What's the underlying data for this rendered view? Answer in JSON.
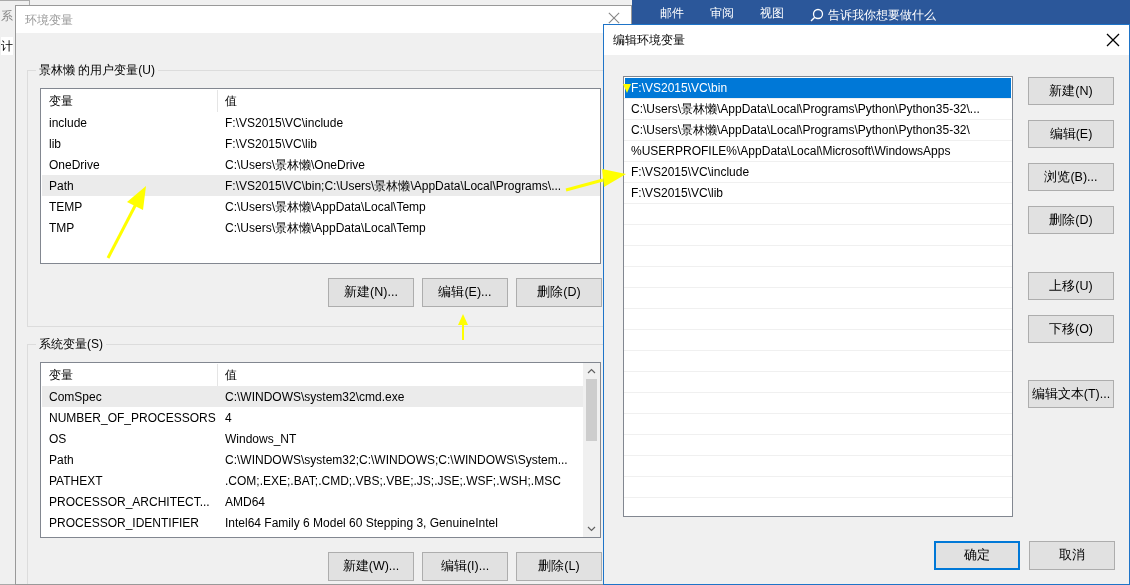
{
  "background_window": {
    "title": "系",
    "tab": "计"
  },
  "ribbon": {
    "tabs": [
      "邮件",
      "审阅",
      "视图"
    ],
    "search_hint": "告诉我你想要做什么"
  },
  "env_dialog": {
    "title": "环境变量",
    "active": false,
    "user_vars": {
      "label": "景林懒 的用户变量(U)",
      "columns": [
        "变量",
        "值"
      ],
      "rows": [
        {
          "name": "include",
          "value": "F:\\VS2015\\VC\\include",
          "selected": false
        },
        {
          "name": "lib",
          "value": "F:\\VS2015\\VC\\lib",
          "selected": false
        },
        {
          "name": "OneDrive",
          "value": "C:\\Users\\景林懒\\OneDrive",
          "selected": false
        },
        {
          "name": "Path",
          "value": "F:\\VS2015\\VC\\bin;C:\\Users\\景林懒\\AppData\\Local\\Programs\\...",
          "selected": true
        },
        {
          "name": "TEMP",
          "value": "C:\\Users\\景林懒\\AppData\\Local\\Temp",
          "selected": false
        },
        {
          "name": "TMP",
          "value": "C:\\Users\\景林懒\\AppData\\Local\\Temp",
          "selected": false
        }
      ],
      "buttons": [
        "新建(N)...",
        "编辑(E)...",
        "删除(D)"
      ]
    },
    "system_vars": {
      "label": "系统变量(S)",
      "columns": [
        "变量",
        "值"
      ],
      "rows": [
        {
          "name": "ComSpec",
          "value": "C:\\WINDOWS\\system32\\cmd.exe",
          "selected": true
        },
        {
          "name": "NUMBER_OF_PROCESSORS",
          "value": "4",
          "selected": false
        },
        {
          "name": "OS",
          "value": "Windows_NT",
          "selected": false
        },
        {
          "name": "Path",
          "value": "C:\\WINDOWS\\system32;C:\\WINDOWS;C:\\WINDOWS\\System...",
          "selected": false
        },
        {
          "name": "PATHEXT",
          "value": ".COM;.EXE;.BAT;.CMD;.VBS;.VBE;.JS;.JSE;.WSF;.WSH;.MSC",
          "selected": false
        },
        {
          "name": "PROCESSOR_ARCHITECT...",
          "value": "AMD64",
          "selected": false
        },
        {
          "name": "PROCESSOR_IDENTIFIER",
          "value": "Intel64 Family 6 Model 60 Stepping 3, GenuineIntel",
          "selected": false
        }
      ],
      "buttons": [
        "新建(W)...",
        "编辑(I)...",
        "删除(L)"
      ]
    }
  },
  "edit_dialog": {
    "title": "编辑环境变量",
    "active": true,
    "entries": [
      {
        "text": "F:\\VS2015\\VC\\bin",
        "selected": true
      },
      {
        "text": "C:\\Users\\景林懒\\AppData\\Local\\Programs\\Python\\Python35-32\\...",
        "selected": false
      },
      {
        "text": "C:\\Users\\景林懒\\AppData\\Local\\Programs\\Python\\Python35-32\\",
        "selected": false
      },
      {
        "text": "%USERPROFILE%\\AppData\\Local\\Microsoft\\WindowsApps",
        "selected": false
      },
      {
        "text": "F:\\VS2015\\VC\\include",
        "selected": false
      },
      {
        "text": "F:\\VS2015\\VC\\lib",
        "selected": false
      }
    ],
    "side_button_groups": [
      [
        "新建(N)",
        "编辑(E)",
        "浏览(B)...",
        "删除(D)"
      ],
      [
        "上移(U)",
        "下移(O)"
      ],
      [
        "编辑文本(T)..."
      ]
    ],
    "footer_buttons": [
      {
        "label": "确定",
        "default": true
      },
      {
        "label": "取消",
        "default": false
      }
    ]
  }
}
